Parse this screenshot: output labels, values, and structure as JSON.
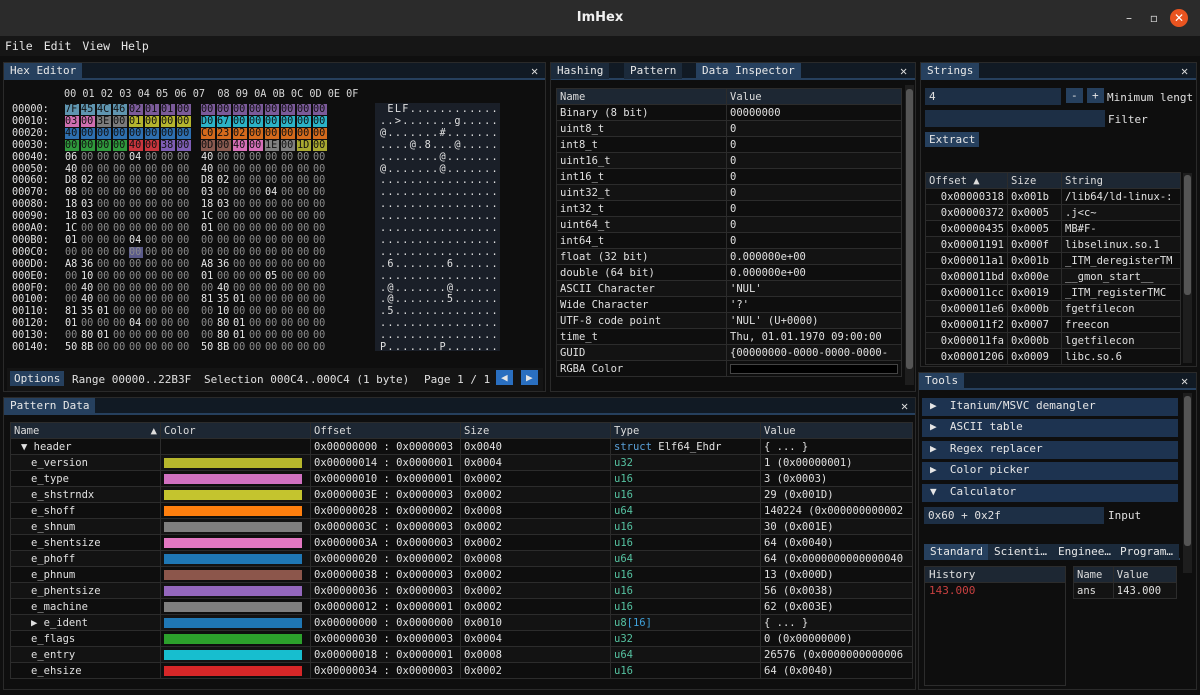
{
  "window": {
    "title": "ImHex",
    "min": "–",
    "max": "▫",
    "close": "✕"
  },
  "menu": [
    "File",
    "Edit",
    "View",
    "Help"
  ],
  "hex": {
    "tab": "Hex Editor",
    "header": "00 01 02 03 04 05 06 07  08 09 0A 0B 0C 0D 0E 0F",
    "rows": [
      {
        "off": "00000:",
        "b": [
          "7F",
          "45",
          "4C",
          "46",
          "02",
          "01",
          "01",
          "00",
          "00",
          "00",
          "00",
          "00",
          "00",
          "00",
          "00",
          "00"
        ],
        "a": " ELF............"
      },
      {
        "off": "00010:",
        "b": [
          "03",
          "00",
          "3E",
          "00",
          "01",
          "00",
          "00",
          "00",
          "D0",
          "67",
          "00",
          "00",
          "00",
          "00",
          "00",
          "00"
        ],
        "a": "..>.......g....."
      },
      {
        "off": "00020:",
        "b": [
          "40",
          "00",
          "00",
          "00",
          "00",
          "00",
          "00",
          "00",
          "C0",
          "23",
          "02",
          "00",
          "00",
          "00",
          "00",
          "00"
        ],
        "a": "@.......#......."
      },
      {
        "off": "00030:",
        "b": [
          "00",
          "00",
          "00",
          "00",
          "40",
          "00",
          "38",
          "00",
          "0D",
          "00",
          "40",
          "00",
          "1E",
          "00",
          "1D",
          "00"
        ],
        "a": "....@.8...@....."
      },
      {
        "off": "00040:",
        "b": [
          "06",
          "00",
          "00",
          "00",
          "04",
          "00",
          "00",
          "00",
          "40",
          "00",
          "00",
          "00",
          "00",
          "00",
          "00",
          "00"
        ],
        "a": "........@......."
      },
      {
        "off": "00050:",
        "b": [
          "40",
          "00",
          "00",
          "00",
          "00",
          "00",
          "00",
          "00",
          "40",
          "00",
          "00",
          "00",
          "00",
          "00",
          "00",
          "00"
        ],
        "a": "@.......@......."
      },
      {
        "off": "00060:",
        "b": [
          "D8",
          "02",
          "00",
          "00",
          "00",
          "00",
          "00",
          "00",
          "D8",
          "02",
          "00",
          "00",
          "00",
          "00",
          "00",
          "00"
        ],
        "a": "................"
      },
      {
        "off": "00070:",
        "b": [
          "08",
          "00",
          "00",
          "00",
          "00",
          "00",
          "00",
          "00",
          "03",
          "00",
          "00",
          "00",
          "04",
          "00",
          "00",
          "00"
        ],
        "a": "................"
      },
      {
        "off": "00080:",
        "b": [
          "18",
          "03",
          "00",
          "00",
          "00",
          "00",
          "00",
          "00",
          "18",
          "03",
          "00",
          "00",
          "00",
          "00",
          "00",
          "00"
        ],
        "a": "................"
      },
      {
        "off": "00090:",
        "b": [
          "18",
          "03",
          "00",
          "00",
          "00",
          "00",
          "00",
          "00",
          "1C",
          "00",
          "00",
          "00",
          "00",
          "00",
          "00",
          "00"
        ],
        "a": "................"
      },
      {
        "off": "000A0:",
        "b": [
          "1C",
          "00",
          "00",
          "00",
          "00",
          "00",
          "00",
          "00",
          "01",
          "00",
          "00",
          "00",
          "00",
          "00",
          "00",
          "00"
        ],
        "a": "................"
      },
      {
        "off": "000B0:",
        "b": [
          "01",
          "00",
          "00",
          "00",
          "04",
          "00",
          "00",
          "00",
          "00",
          "00",
          "00",
          "00",
          "00",
          "00",
          "00",
          "00"
        ],
        "a": "................"
      },
      {
        "off": "000C0:",
        "b": [
          "00",
          "00",
          "00",
          "00",
          "00",
          "00",
          "00",
          "00",
          "00",
          "00",
          "00",
          "00",
          "00",
          "00",
          "00",
          "00"
        ],
        "a": "................"
      },
      {
        "off": "000D0:",
        "b": [
          "A8",
          "36",
          "00",
          "00",
          "00",
          "00",
          "00",
          "00",
          "A8",
          "36",
          "00",
          "00",
          "00",
          "00",
          "00",
          "00"
        ],
        "a": ".6.......6......"
      },
      {
        "off": "000E0:",
        "b": [
          "00",
          "10",
          "00",
          "00",
          "00",
          "00",
          "00",
          "00",
          "01",
          "00",
          "00",
          "00",
          "05",
          "00",
          "00",
          "00"
        ],
        "a": "................"
      },
      {
        "off": "000F0:",
        "b": [
          "00",
          "40",
          "00",
          "00",
          "00",
          "00",
          "00",
          "00",
          "00",
          "40",
          "00",
          "00",
          "00",
          "00",
          "00",
          "00"
        ],
        "a": ".@.......@......"
      },
      {
        "off": "00100:",
        "b": [
          "00",
          "40",
          "00",
          "00",
          "00",
          "00",
          "00",
          "00",
          "81",
          "35",
          "01",
          "00",
          "00",
          "00",
          "00",
          "00"
        ],
        "a": ".@.......5......"
      },
      {
        "off": "00110:",
        "b": [
          "81",
          "35",
          "01",
          "00",
          "00",
          "00",
          "00",
          "00",
          "00",
          "10",
          "00",
          "00",
          "00",
          "00",
          "00",
          "00"
        ],
        "a": ".5.............."
      },
      {
        "off": "00120:",
        "b": [
          "01",
          "00",
          "00",
          "00",
          "04",
          "00",
          "00",
          "00",
          "00",
          "80",
          "01",
          "00",
          "00",
          "00",
          "00",
          "00"
        ],
        "a": "................"
      },
      {
        "off": "00130:",
        "b": [
          "00",
          "80",
          "01",
          "00",
          "00",
          "00",
          "00",
          "00",
          "00",
          "80",
          "01",
          "00",
          "00",
          "00",
          "00",
          "00"
        ],
        "a": "................"
      },
      {
        "off": "00140:",
        "b": [
          "50",
          "8B",
          "00",
          "00",
          "00",
          "00",
          "00",
          "00",
          "50",
          "8B",
          "00",
          "00",
          "00",
          "00",
          "00",
          "00"
        ],
        "a": "P.......P......."
      }
    ],
    "colors": {
      "magic": "#5f95b0",
      "cls": "#7b5a9a",
      "etype": "#cf6fb0",
      "mach": "#7b7b7b",
      "ver": "#b5b52e",
      "entry": "#2bb3c7",
      "phoff": "#2d6fb0",
      "shoff": "#d46a1c",
      "flags": "#2f9a3c",
      "ehsize": "#c9353d",
      "phentsize": "#7e5db5",
      "phnum": "#8a5a50",
      "shentsize": "#d66fb8",
      "shnum": "#808080",
      "shstrndx": "#a8a830"
    },
    "options": "Options",
    "range": "Range 00000..22B3F",
    "selection": "Selection 000C4..000C4 (1 byte)",
    "page": "Page 1 / 1",
    "prev": "◀",
    "next": "▶"
  },
  "inspector": {
    "tabs": [
      "Hashing",
      "Pattern",
      "Data Inspector"
    ],
    "headers": [
      "Name",
      "Value"
    ],
    "rows": [
      [
        "Binary (8 bit)",
        "00000000"
      ],
      [
        "uint8_t",
        "0"
      ],
      [
        "int8_t",
        "0"
      ],
      [
        "uint16_t",
        "0"
      ],
      [
        "int16_t",
        "0"
      ],
      [
        "uint32_t",
        "0"
      ],
      [
        "int32_t",
        "0"
      ],
      [
        "uint64_t",
        "0"
      ],
      [
        "int64_t",
        "0"
      ],
      [
        "float (32 bit)",
        "0.000000e+00"
      ],
      [
        "double (64 bit)",
        "0.000000e+00"
      ],
      [
        "ASCII Character",
        "'NUL'"
      ],
      [
        "Wide Character",
        "'?'"
      ],
      [
        "UTF-8 code point",
        "'NUL' (U+0000)"
      ],
      [
        "time_t",
        "Thu, 01.01.1970 09:00:00"
      ],
      [
        "GUID",
        "{00000000-0000-0000-0000-"
      ],
      [
        "RGBA Color",
        ""
      ]
    ]
  },
  "strings": {
    "tab": "Strings",
    "min_value": "4",
    "minus": "-",
    "plus": "+",
    "min_label": "Minimum lengt",
    "filter_label": "Filter",
    "extract": "Extract",
    "headers": [
      "Offset",
      "Size",
      "String"
    ],
    "rows": [
      [
        "0x00000318",
        "0x001b",
        "/lib64/ld-linux-:"
      ],
      [
        "0x00000372",
        "0x0005",
        ".j<c~"
      ],
      [
        "0x00000435",
        "0x0005",
        "MB#F-"
      ],
      [
        "0x00001191",
        "0x000f",
        "libselinux.so.1"
      ],
      [
        "0x000011a1",
        "0x001b",
        "_ITM_deregisterTM"
      ],
      [
        "0x000011bd",
        "0x000e",
        "__gmon_start__"
      ],
      [
        "0x000011cc",
        "0x0019",
        "_ITM_registerTMC"
      ],
      [
        "0x000011e6",
        "0x000b",
        "fgetfilecon"
      ],
      [
        "0x000011f2",
        "0x0007",
        "freecon"
      ],
      [
        "0x000011fa",
        "0x000b",
        "lgetfilecon"
      ],
      [
        "0x00001206",
        "0x0009",
        "libc.so.6"
      ]
    ]
  },
  "tools": {
    "tab": "Tools",
    "items": [
      "Itanium/MSVC demangler",
      "ASCII table",
      "Regex replacer",
      "Color picker",
      "Calculator"
    ],
    "calc_input": "0x60 + 0x2f",
    "input_label": "Input",
    "calc_tabs": [
      "Standard",
      "Scienti…",
      "Enginee…",
      "Program…"
    ],
    "history_header": "History",
    "history_value": "143.000",
    "var_headers": [
      "Name",
      "Value"
    ],
    "var_row": [
      "ans",
      "143.000"
    ]
  },
  "pattern": {
    "tab": "Pattern Data",
    "headers": [
      "Name",
      "Color",
      "Offset",
      "Size",
      "Type",
      "Value"
    ],
    "rows": [
      {
        "name": "▼ header",
        "color": "",
        "offset": "0x00000000 : 0x0000003",
        "size": "0x0040",
        "type_kw": "struct",
        "type": "Elf64_Ehdr",
        "value": "{ ... }"
      },
      {
        "name": "e_version",
        "color": "#b7b72c",
        "offset": "0x00000014 : 0x0000001",
        "size": "0x0004",
        "type_kw": "u32",
        "type": "",
        "value": "1 (0x00000001)"
      },
      {
        "name": "e_type",
        "color": "#d070c0",
        "offset": "0x00000010 : 0x0000001",
        "size": "0x0002",
        "type_kw": "u16",
        "type": "",
        "value": "3 (0x0003)"
      },
      {
        "name": "e_shstrndx",
        "color": "#c4c42e",
        "offset": "0x0000003E : 0x0000003",
        "size": "0x0002",
        "type_kw": "u16",
        "type": "",
        "value": "29 (0x001D)"
      },
      {
        "name": "e_shoff",
        "color": "#ff7f0e",
        "offset": "0x00000028 : 0x0000002",
        "size": "0x0008",
        "type_kw": "u64",
        "type": "",
        "value": "140224 (0x000000000002"
      },
      {
        "name": "e_shnum",
        "color": "#7f7f7f",
        "offset": "0x0000003C : 0x0000003",
        "size": "0x0002",
        "type_kw": "u16",
        "type": "",
        "value": "30 (0x001E)"
      },
      {
        "name": "e_shentsize",
        "color": "#e377c2",
        "offset": "0x0000003A : 0x0000003",
        "size": "0x0002",
        "type_kw": "u16",
        "type": "",
        "value": "64 (0x0040)"
      },
      {
        "name": "e_phoff",
        "color": "#1f77b4",
        "offset": "0x00000020 : 0x0000002",
        "size": "0x0008",
        "type_kw": "u64",
        "type": "",
        "value": "64 (0x0000000000000040"
      },
      {
        "name": "e_phnum",
        "color": "#8c564b",
        "offset": "0x00000038 : 0x0000003",
        "size": "0x0002",
        "type_kw": "u16",
        "type": "",
        "value": "13 (0x000D)"
      },
      {
        "name": "e_phentsize",
        "color": "#9467bd",
        "offset": "0x00000036 : 0x0000003",
        "size": "0x0002",
        "type_kw": "u16",
        "type": "",
        "value": "56 (0x0038)"
      },
      {
        "name": "e_machine",
        "color": "#7f7f7f",
        "offset": "0x00000012 : 0x0000001",
        "size": "0x0002",
        "type_kw": "u16",
        "type": "",
        "value": "62 (0x003E)"
      },
      {
        "name": "▶ e_ident",
        "color": "#1f77b4",
        "offset": "0x00000000 : 0x0000000",
        "size": "0x0010",
        "type_kw": "u8",
        "type": "[16]",
        "value": "{ ... }"
      },
      {
        "name": "e_flags",
        "color": "#2ca02c",
        "offset": "0x00000030 : 0x0000003",
        "size": "0x0004",
        "type_kw": "u32",
        "type": "",
        "value": "0 (0x00000000)"
      },
      {
        "name": "e_entry",
        "color": "#17becf",
        "offset": "0x00000018 : 0x0000001",
        "size": "0x0008",
        "type_kw": "u64",
        "type": "",
        "value": "26576 (0x0000000000006"
      },
      {
        "name": "e_ehsize",
        "color": "#d62728",
        "offset": "0x00000034 : 0x0000003",
        "size": "0x0002",
        "type_kw": "u16",
        "type": "",
        "value": "64 (0x0040)"
      }
    ]
  }
}
